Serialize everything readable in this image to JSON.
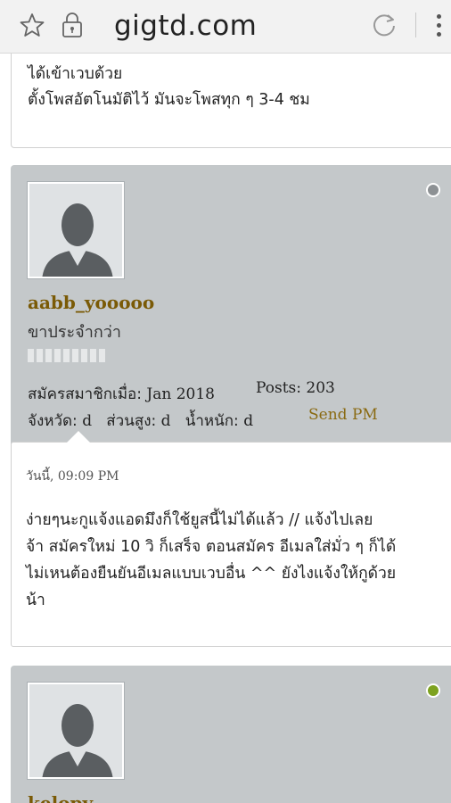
{
  "browser": {
    "url": "gigtd.com"
  },
  "previous_post": {
    "line1": "ได้เข้าเวบด้วย",
    "line2": "ตั้งโพสอัตโนมัติไว้ มันจะโพสทุก ๆ 3-4 ชม"
  },
  "posts": [
    {
      "username": "aabb_yooooo",
      "user_title": "ขาประจำกว่า",
      "reputation_bars": 9,
      "joined_label": "สมัครสมาชิกเมื่อ:",
      "joined_value": "Jan 2018",
      "posts_label": "Posts:",
      "posts_value": "203",
      "province_label": "จังหวัด:",
      "province_value": "d",
      "height_label": "ส่วนสูง:",
      "height_value": "d",
      "weight_label": "น้ำหนัก:",
      "weight_value": "d",
      "send_pm": "Send PM",
      "status": "offline",
      "date": "วันนี้, 09:09 PM",
      "content_line1": "ง่ายๆนะกูแจ้งแอดมึงก็ใช้ยูสนี้ไม่ได้แล้ว // แจ้งไปเลย",
      "content_line2": "จ้า สมัครใหม่ 10 วิ ก็เสร็จ ตอนสมัคร อีเมลใส่มั่ว ๆ ก็ได้",
      "content_line3": "ไม่เหนต้องยืนยันอีเมลแบบเวบอื่น ^^ ยังไงแจ้งให้กูด้วย",
      "content_line4": "น้า"
    },
    {
      "username": "kelopy",
      "status": "online"
    }
  ],
  "colors": {
    "postbit_bg": "#c4c8ca",
    "username": "#7a5a06",
    "send_pm": "#8a6a12",
    "online": "#7da21f",
    "offline": "#8d9194"
  }
}
